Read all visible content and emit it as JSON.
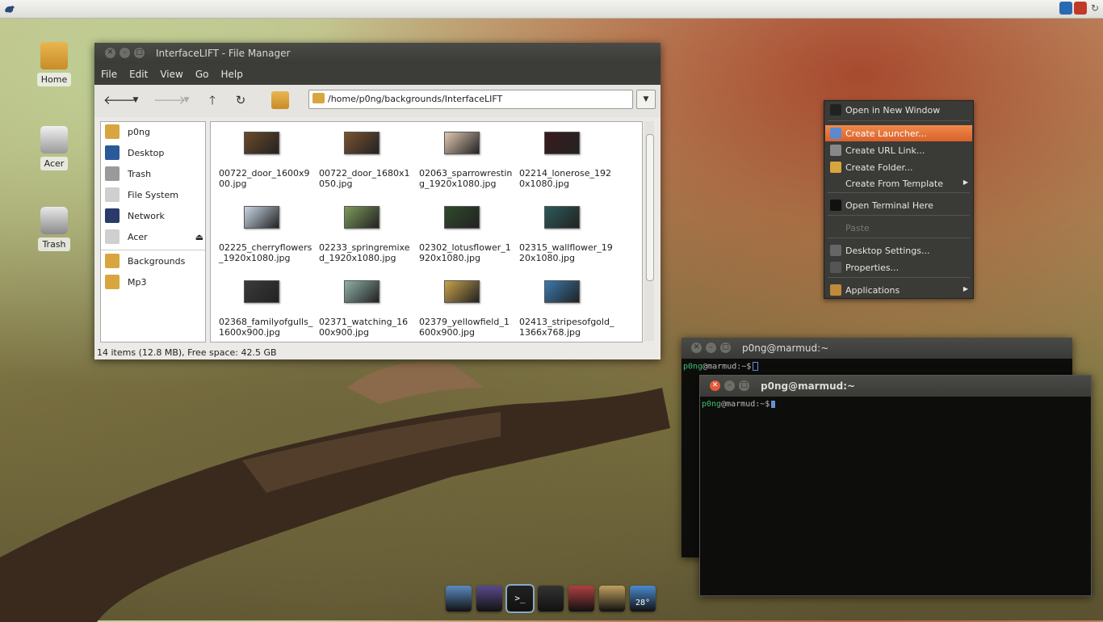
{
  "desktop": {
    "icons": [
      {
        "label": "Home",
        "icon": "home-folder-icon"
      },
      {
        "label": "Acer",
        "icon": "drive-icon"
      },
      {
        "label": "Trash",
        "icon": "trash-icon"
      }
    ]
  },
  "file_manager": {
    "title": "InterfaceLIFT - File Manager",
    "menu": [
      "File",
      "Edit",
      "View",
      "Go",
      "Help"
    ],
    "path": "/home/p0ng/backgrounds/InterfaceLIFT",
    "sidebar": {
      "places": [
        "p0ng",
        "Desktop",
        "Trash",
        "File System",
        "Network",
        "Acer"
      ],
      "bookmarks": [
        "Backgrounds",
        "Mp3"
      ]
    },
    "files": [
      {
        "line1": "00722_door_1600x9",
        "line2": "00.jpg",
        "color": "#6b4a2a"
      },
      {
        "line1": "00722_door_1680x1",
        "line2": "050.jpg",
        "color": "#7a5330"
      },
      {
        "line1": "02063_sparrowrestin",
        "line2": "g_1920x1080.jpg",
        "color": "#e0c8b0"
      },
      {
        "line1": "02214_lonerose_192",
        "line2": "0x1080.jpg",
        "color": "#3a1a1e"
      },
      {
        "line1": "02225_cherryflowers",
        "line2": "_1920x1080.jpg",
        "color": "#c9d6e6"
      },
      {
        "line1": "02233_springremixe",
        "line2": "d_1920x1080.jpg",
        "color": "#7c9a5a"
      },
      {
        "line1": "02302_lotusflower_1",
        "line2": "920x1080.jpg",
        "color": "#2f4a2a"
      },
      {
        "line1": "02315_wallflower_19",
        "line2": "20x1080.jpg",
        "color": "#2c5a5a"
      },
      {
        "line1": "02368_familyofgulls_",
        "line2": "1600x900.jpg",
        "color": "#3a3a3a"
      },
      {
        "line1": "02371_watching_16",
        "line2": "00x900.jpg",
        "color": "#8fb0a8"
      },
      {
        "line1": "02379_yellowfield_1",
        "line2": "600x900.jpg",
        "color": "#c9a24a"
      },
      {
        "line1": "02413_stripesofgold_",
        "line2": "1366x768.jpg",
        "color": "#3a7ab0"
      }
    ],
    "status": "14 items (12.8 MB), Free space: 42.5 GB"
  },
  "context_menu": {
    "items": [
      {
        "label": "Open in New Window",
        "icon": "window-icon"
      },
      {
        "label": "Create Launcher...",
        "icon": "launcher-icon"
      },
      {
        "label": "Create URL Link...",
        "icon": "link-icon"
      },
      {
        "label": "Create Folder...",
        "icon": "folder-icon"
      },
      {
        "label": "Create From Template",
        "icon": ""
      },
      {
        "label": "Open Terminal Here",
        "icon": "terminal-icon"
      },
      {
        "label": "Paste",
        "icon": ""
      },
      {
        "label": "Desktop Settings...",
        "icon": "settings-icon"
      },
      {
        "label": "Properties...",
        "icon": "properties-icon"
      },
      {
        "label": "Applications",
        "icon": "applications-icon"
      }
    ]
  },
  "terminals": [
    {
      "title": "p0ng@marmud:~",
      "user": "p0ng",
      "host": "@marmud",
      "prompt": ":~$"
    },
    {
      "title": "p0ng@marmud:~",
      "user": "p0ng",
      "host": "@marmud",
      "prompt": ":~$"
    }
  ],
  "dock": {
    "items": [
      {
        "name": "browser-icon",
        "color": "#5a8ac0"
      },
      {
        "name": "pidgin-icon",
        "color": "#5a4a8a"
      },
      {
        "name": "terminal-icon",
        "color": "#222"
      },
      {
        "name": "app-a-icon",
        "color": "#333"
      },
      {
        "name": "system-icon",
        "color": "#b04040"
      },
      {
        "name": "paint-icon",
        "color": "#c0a060"
      },
      {
        "name": "weather-icon",
        "color": "#4a8ad0"
      }
    ],
    "weather_temp": "28°"
  },
  "colors": {
    "accent": "#e6743a",
    "terminal_user": "#3fbf6f",
    "cursor": "#6a8fd0"
  }
}
